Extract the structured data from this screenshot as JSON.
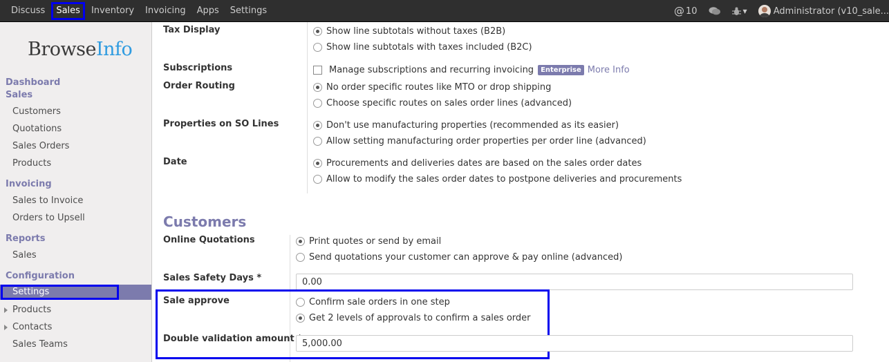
{
  "topbar": {
    "menu": [
      "Discuss",
      "Sales",
      "Inventory",
      "Invoicing",
      "Apps",
      "Settings"
    ],
    "active": "Sales",
    "mentions_count": "10",
    "user": "Administrator (v10_sale..."
  },
  "sidebar": {
    "logo_part1": "Browse",
    "logo_part2": "Info",
    "sections": {
      "dashboard": "Dashboard",
      "sales": "Sales",
      "invoicing": "Invoicing",
      "reports": "Reports",
      "configuration": "Configuration"
    },
    "items": {
      "customers": "Customers",
      "quotations": "Quotations",
      "sales_orders": "Sales Orders",
      "products": "Products",
      "sales_to_invoice": "Sales to Invoice",
      "orders_to_upsell": "Orders to Upsell",
      "reports_sales": "Sales",
      "settings": "Settings",
      "config_products": "Products",
      "contacts": "Contacts",
      "sales_teams": "Sales Teams"
    }
  },
  "settings": {
    "tax_display": {
      "label": "Tax Display",
      "options": [
        "Show line subtotals without taxes (B2B)",
        "Show line subtotals with taxes included (B2C)"
      ],
      "selected": 0
    },
    "subscriptions": {
      "label": "Subscriptions",
      "checkbox_label": "Manage subscriptions and recurring invoicing",
      "badge": "Enterprise",
      "more": "More Info",
      "checked": false
    },
    "order_routing": {
      "label": "Order Routing",
      "options": [
        "No order specific routes like MTO or drop shipping",
        "Choose specific routes on sales order lines (advanced)"
      ],
      "selected": 0
    },
    "properties": {
      "label": "Properties on SO Lines",
      "options": [
        "Don't use manufacturing properties (recommended as its easier)",
        "Allow setting manufacturing order properties per order line (advanced)"
      ],
      "selected": 0
    },
    "date": {
      "label": "Date",
      "options": [
        "Procurements and deliveries dates are based on the sales order dates",
        "Allow to modify the sales order dates to postpone deliveries and procurements"
      ],
      "selected": 0
    },
    "customers_heading": "Customers",
    "online_quotations": {
      "label": "Online Quotations",
      "options": [
        "Print quotes or send by email",
        "Send quotations your customer can approve & pay online (advanced)"
      ],
      "selected": 0
    },
    "safety_days": {
      "label": "Sales Safety Days *",
      "value": "0.00"
    },
    "sale_approve": {
      "label": "Sale approve",
      "options": [
        "Confirm sale orders in one step",
        "Get 2 levels of approvals to confirm a sales order"
      ],
      "selected": 1
    },
    "double_validation": {
      "label": "Double validation amount *",
      "value": "5,000.00"
    }
  }
}
